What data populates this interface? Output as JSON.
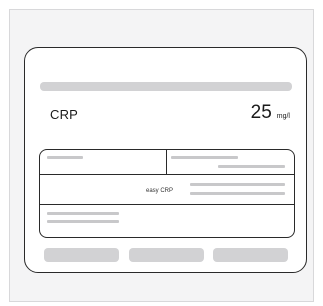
{
  "result": {
    "test_name": "CRP",
    "value": "25",
    "unit": "mg/l"
  },
  "table": {
    "method_label": "easy CRP"
  }
}
